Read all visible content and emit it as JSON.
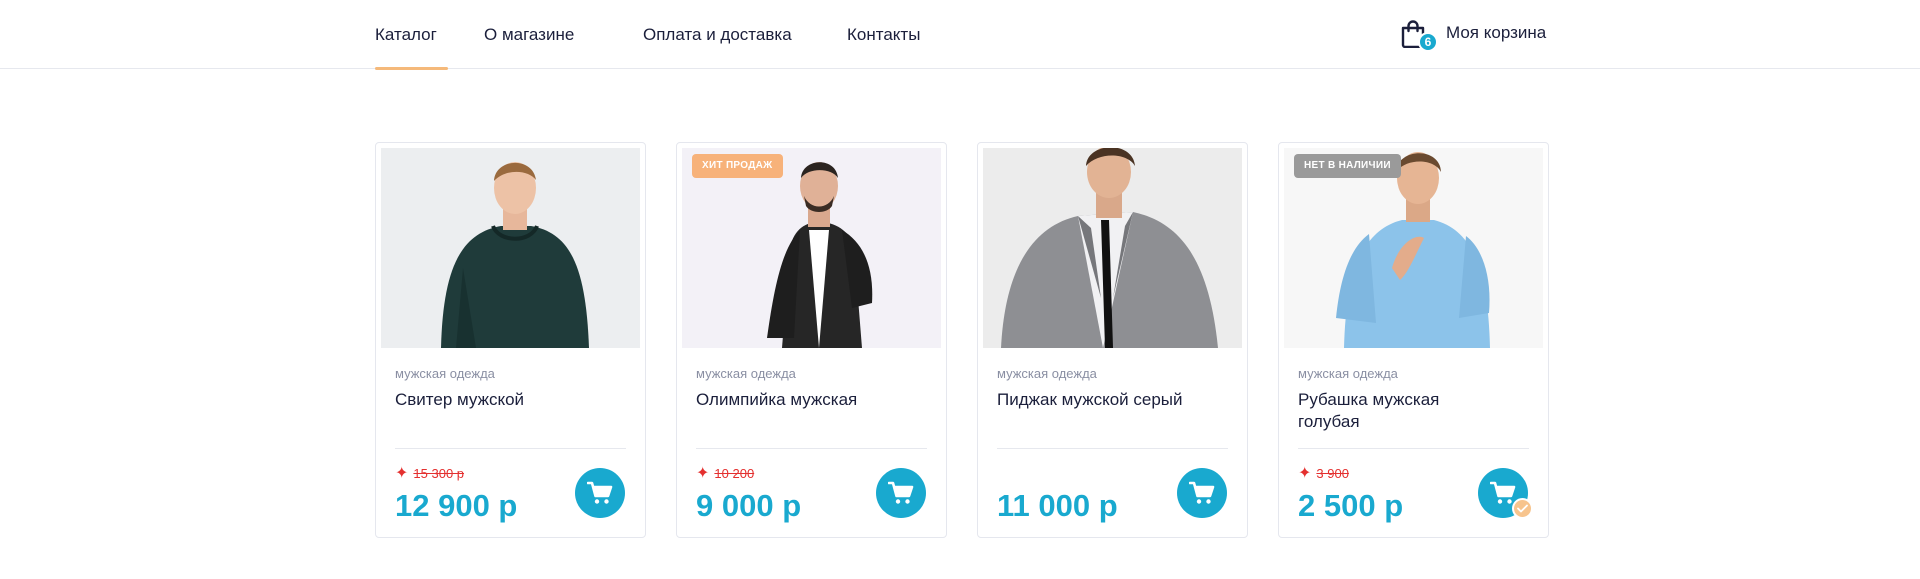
{
  "nav": {
    "items": [
      {
        "label": "Каталог",
        "active": true
      },
      {
        "label": "О магазине",
        "active": false
      },
      {
        "label": "Оплата и доставка",
        "active": false
      },
      {
        "label": "Контакты",
        "active": false
      }
    ]
  },
  "cart": {
    "label": "Моя корзина",
    "count": "6",
    "icon": "shopping-bag-icon"
  },
  "colors": {
    "accent": "#19a9cf",
    "active_underline": "#f5b97a",
    "old_price": "#e4302f",
    "badge_hit": "#f7b27a",
    "badge_out": "#9a9a9a"
  },
  "products": [
    {
      "category": "мужская одежда",
      "title": "Свитер мужской",
      "old_price": "15 300 р",
      "price": "12 900 р",
      "badge": "",
      "in_cart": false,
      "image": "man-dark-green-sweater"
    },
    {
      "category": "мужская одежда",
      "title": "Олимпийка мужская",
      "old_price": "10 200",
      "price": "9 000 р",
      "badge": "ХИТ ПРОДАЖ",
      "in_cart": false,
      "image": "man-black-bomber-jacket"
    },
    {
      "category": "мужская одежда",
      "title": "Пиджак мужской серый",
      "old_price": "",
      "price": "11 000 р",
      "badge": "",
      "in_cart": false,
      "image": "man-grey-blazer"
    },
    {
      "category": "мужская одежда",
      "title": "Рубашка мужская голубая",
      "old_price": "3 900",
      "price": "2 500 р",
      "badge": "НЕТ В НАЛИЧИИ",
      "in_cart": true,
      "image": "man-light-blue-shirt"
    }
  ]
}
